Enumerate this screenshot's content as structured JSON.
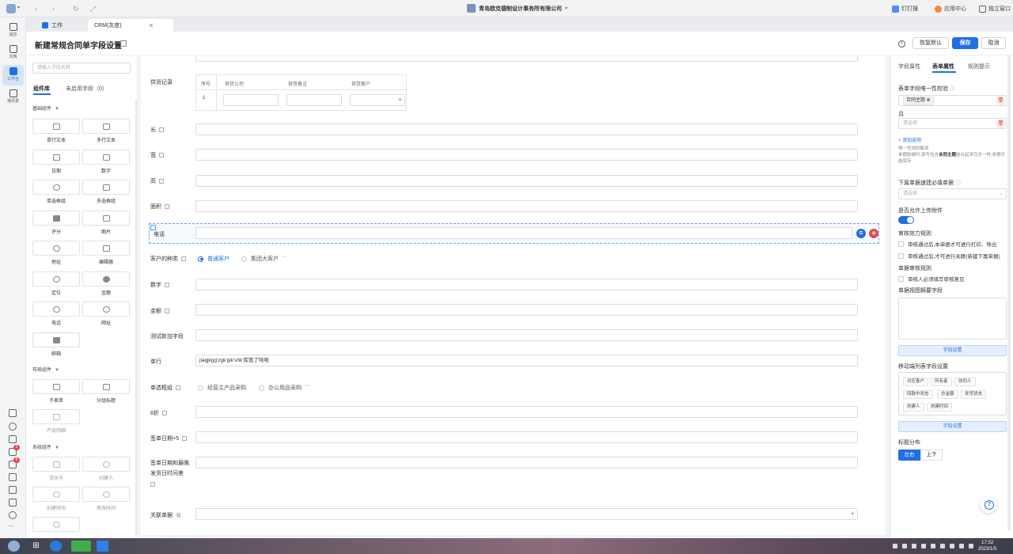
{
  "titlebar": {
    "company": "青岛欧克德制设计事务所有限公司",
    "right": [
      "钉钉搜",
      "应用中心",
      "独立窗口"
    ]
  },
  "rail": {
    "items": [
      "消息",
      "文档",
      "工作台",
      "通讯录"
    ],
    "badges": [
      "2",
      "9"
    ]
  },
  "tabs": [
    "工作",
    "CRM(灰度)"
  ],
  "header": {
    "title": "新建常规合同单字段设置",
    "restore_label": "恢复默认",
    "save_label": "保存",
    "cancel_label": "取消"
  },
  "components": {
    "search_placeholder": "请输入字段名称",
    "tabs": [
      "组件库",
      "未启用字段（0）"
    ],
    "groups": [
      {
        "title": "基础组件",
        "items": [
          "单行文本",
          "多行文本",
          "日期",
          "数字",
          "单选框组",
          "多选框组",
          "评分",
          "图片",
          "地址",
          "编辑器",
          "定位",
          "金额",
          "电话",
          "网址",
          "邮箱"
        ]
      },
      {
        "title": "布局组件",
        "items": [
          "子表单",
          "分组标题",
          "产品明细"
        ]
      },
      {
        "title": "系统组件",
        "items": [
          "流水号",
          "创建人",
          "创建时间",
          "修改时间"
        ]
      }
    ]
  },
  "form": {
    "supply": {
      "label": "供货记录",
      "headers": [
        "序号",
        "供货公司",
        "供货备注",
        "供货客户"
      ],
      "row_no": "1"
    },
    "fields": [
      {
        "label": "长"
      },
      {
        "label": "宽"
      },
      {
        "label": "高"
      },
      {
        "label": "面积"
      },
      {
        "label": "电话"
      },
      {
        "label": "数字"
      },
      {
        "label": "金额"
      },
      {
        "label": "测试新加字段"
      },
      {
        "label": "单行",
        "value": "jlagjkgg'zgk'gik'shk'库管了哈哈"
      },
      {
        "label": "8折"
      },
      {
        "label": "签单日期+5"
      },
      {
        "label": "签单日期和最晚发货日时间差"
      },
      {
        "label": "关联单据"
      }
    ],
    "customer_type": {
      "label": "客户的种类",
      "options": [
        "普通客户",
        "集团大客户"
      ],
      "more": "···"
    },
    "single_choice": {
      "label": "单选框组",
      "options": [
        "经营主产品采购",
        "办公用品采购"
      ],
      "more": "···"
    }
  },
  "props": {
    "tabs": [
      "字段属性",
      "表单属性",
      "规则提示"
    ],
    "unique_label": "表单字段唯一性校验",
    "unique_tag": "合同主题",
    "and_label": "且",
    "select_placeholder": "请选择",
    "add_option": "+ 添加选项",
    "note_title": "唯一性规则解读",
    "note_pre": "单据新建时,填写包含",
    "note_bold": "合同主题",
    "note_post": "结合起来完全一样,单据不能保存",
    "must_fill_label": "下属单据速建必填单据",
    "must_fill_placeholder": "请选择",
    "allow_upload_label": "是否允许上传附件",
    "audit_label": "审核效力规则",
    "audit_options": [
      "审核通过后,本单据才可进行打印、导出",
      "审核通过后,才可进行关联(新建下属单据)"
    ],
    "doc_audit_label": "单据审核规则",
    "doc_audit_option": "审核人必须填写审核意见",
    "summary_label": "单据视图摘要字段",
    "field_settings": "字段设置",
    "mobile_label": "移动端列表字段设置",
    "mobile_chips": [
      "对应客户",
      "所有者",
      "协同人",
      "回款中状态",
      "总金额",
      "发货状态",
      "创建人",
      "创建时间"
    ],
    "layout_label": "标题分布",
    "layout_options": [
      "左右",
      "上下"
    ]
  },
  "taskbar": {
    "time": "17:52",
    "date": "2023/1/5"
  }
}
